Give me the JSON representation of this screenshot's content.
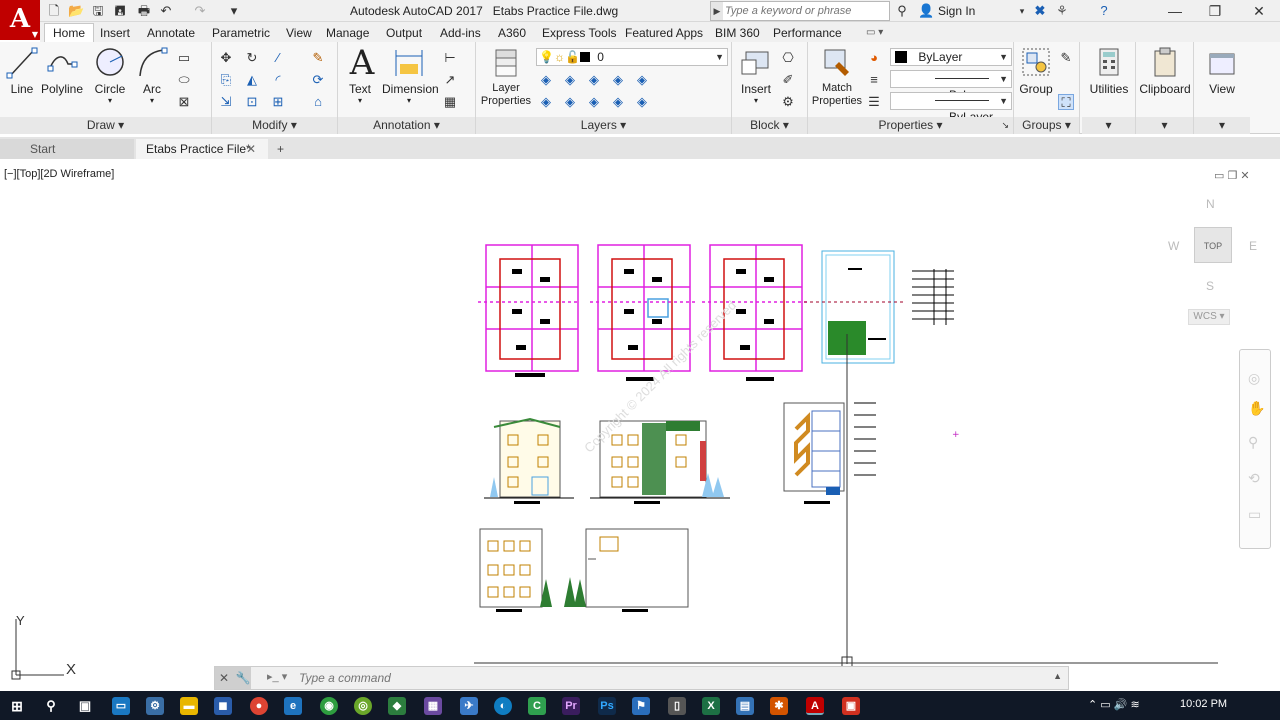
{
  "titlebar": {
    "app_name": "Autodesk AutoCAD 2017",
    "file_name": "Etabs Practice File.dwg",
    "search_placeholder": "Type a keyword or phrase",
    "sign_in": "Sign In",
    "logo_letter": "A"
  },
  "menu_tabs": [
    "Home",
    "Insert",
    "Annotate",
    "Parametric",
    "View",
    "Manage",
    "Output",
    "Add-ins",
    "A360",
    "Express Tools",
    "Featured Apps",
    "BIM 360",
    "Performance"
  ],
  "ribbon": {
    "draw": {
      "title": "Draw",
      "tools": [
        "Line",
        "Polyline",
        "Circle",
        "Arc"
      ]
    },
    "modify": {
      "title": "Modify"
    },
    "annotation": {
      "title": "Annotation",
      "tools": [
        "Text",
        "Dimension"
      ]
    },
    "layers": {
      "title": "Layers",
      "tool": "Layer Properties",
      "current_layer": "0"
    },
    "block": {
      "title": "Block",
      "tool": "Insert"
    },
    "properties": {
      "title": "Properties",
      "tool": "Match Properties",
      "color": "ByLayer",
      "linetype": "ByLayer",
      "lineweight": "ByLayer"
    },
    "groups": {
      "title": "Groups",
      "tool": "Group"
    },
    "utilities": "Utilities",
    "clipboard": "Clipboard",
    "view": "View"
  },
  "file_tabs": {
    "start": "Start",
    "active": "Etabs Practice File*"
  },
  "canvas": {
    "view_label": "[−][Top][2D Wireframe]",
    "viewcube": {
      "top": "TOP",
      "n": "N",
      "s": "S",
      "e": "E",
      "w": "W",
      "wcs": "WCS"
    },
    "ucs_x": "X",
    "ucs_y": "Y",
    "command_placeholder": "Type a command",
    "watermark": "Copyright © 2024 All rights reserved"
  },
  "taskbar": {
    "time": "10:02 PM"
  },
  "colors": {
    "accent": "#c00000",
    "taskbar": "#101826",
    "ribbon": "#f7f7f7"
  }
}
